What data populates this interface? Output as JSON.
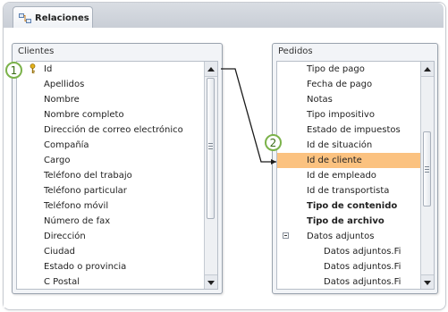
{
  "tab": {
    "label": "Relaciones",
    "icon": "relationships-icon"
  },
  "clientes": {
    "title": "Clientes",
    "fields": [
      "Id",
      "Apellidos",
      "Nombre",
      "Nombre completo",
      "Dirección de correo electrónico",
      "Compañía",
      "Cargo",
      "Teléfono del trabajo",
      "Teléfono particular",
      "Teléfono móvil",
      "Número de fax",
      "Dirección",
      "Ciudad",
      "Estado o provincia",
      "C Postal"
    ]
  },
  "pedidos": {
    "title": "Pedidos",
    "fields": [
      "Tipo de pago",
      "Fecha de pago",
      "Notas",
      "Tipo impositivo",
      "Estado de impuestos",
      "Id de situación",
      "Id de cliente",
      "Id de empleado",
      "Id de transportista",
      "Tipo de contenido",
      "Tipo de archivo",
      "Datos adjuntos",
      "Datos adjuntos.Fi",
      "Datos adjuntos.Fi",
      "Datos adjuntos.Fi"
    ],
    "selected_field": "Id de cliente"
  },
  "callouts": {
    "one": "1",
    "two": "2"
  },
  "colors": {
    "selection": "#fbc280",
    "callout": "#7bb24a"
  }
}
